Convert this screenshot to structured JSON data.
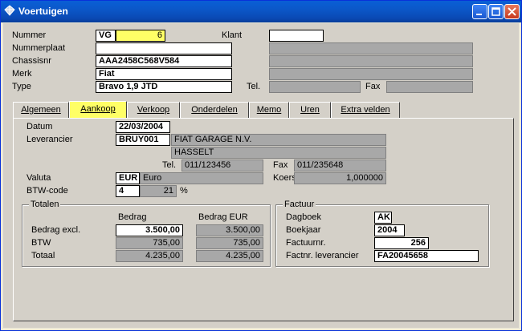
{
  "window": {
    "title": "Voertuigen"
  },
  "header": {
    "nummer_label": "Nummer",
    "nummer_prefix": "VG",
    "nummer_value": "6",
    "nummerplaat_label": "Nummerplaat",
    "nummerplaat_value": "",
    "chassisnr_label": "Chassisnr",
    "chassisnr_value": "AAA2458C568V584",
    "merk_label": "Merk",
    "merk_value": "Fiat",
    "type_label": "Type",
    "type_value": "Bravo 1,9 JTD",
    "klant_label": "Klant",
    "klant_value": "",
    "tel_label": "Tel.",
    "fax_label": "Fax"
  },
  "tabs": [
    {
      "label": "Algemeen"
    },
    {
      "label": "Aankoop"
    },
    {
      "label": "Verkoop"
    },
    {
      "label": "Onderdelen"
    },
    {
      "label": "Memo"
    },
    {
      "label": "Uren"
    },
    {
      "label": "Extra velden"
    }
  ],
  "aankoop": {
    "datum_label": "Datum",
    "datum_value": "22/03/2004",
    "leverancier_label": "Leverancier",
    "leverancier_code": "BRUY001",
    "leverancier_name": "FIAT GARAGE N.V.",
    "leverancier_city": "HASSELT",
    "tel_label": "Tel.",
    "tel_value": "011/123456",
    "fax_label": "Fax",
    "fax_value": "011/235648",
    "valuta_label": "Valuta",
    "valuta_code": "EUR",
    "valuta_name": "Euro",
    "koers_label": "Koers",
    "koers_value": "1,000000",
    "btw_label": "BTW-code",
    "btw_code": "4",
    "btw_pct": "21",
    "btw_pct_sign": "%"
  },
  "totalen": {
    "title": "Totalen",
    "col_bedrag": "Bedrag",
    "col_bedrag_eur": "Bedrag EUR",
    "rows": [
      {
        "label": "Bedrag excl.",
        "bedrag": "3.500,00",
        "bedrag_eur": "3.500,00"
      },
      {
        "label": "BTW",
        "bedrag": "735,00",
        "bedrag_eur": "735,00"
      },
      {
        "label": "Totaal",
        "bedrag": "4.235,00",
        "bedrag_eur": "4.235,00"
      }
    ]
  },
  "factuur": {
    "title": "Factuur",
    "dagboek_label": "Dagboek",
    "dagboek_value": "AK",
    "boekjaar_label": "Boekjaar",
    "boekjaar_value": "2004",
    "factuurnr_label": "Factuurnr.",
    "factuurnr_value": "256",
    "factnr_lev_label": "Factnr. leverancier",
    "factnr_lev_value": "FA20045658"
  }
}
